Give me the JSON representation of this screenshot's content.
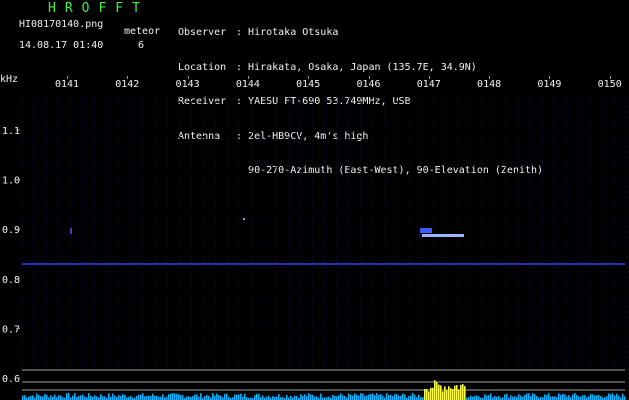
{
  "app_title": "HROFFT",
  "file_name": "HI08170140.png",
  "timestamp": "14.08.17 01:40",
  "meteor_label": "meteor",
  "meteor_count": "6",
  "station": [
    {
      "key": "Observer",
      "value": "Hirotaka Otsuka"
    },
    {
      "key": "Location",
      "value": "Hirakata, Osaka, Japan (135.7E, 34.9N)"
    },
    {
      "key": "Receiver",
      "value": "YAESU FT-690 53.749MHz, USB"
    },
    {
      "key": "Antenna",
      "value": "2el-HB9CV, 4m's high"
    },
    {
      "key": "",
      "value": "90-270-Azimuth (East-West), 90-Elevation (Zenith)"
    }
  ],
  "freq_unit": "kHz",
  "time_ticks": [
    "0141",
    "0142",
    "0143",
    "0144",
    "0145",
    "0146",
    "0147",
    "0148",
    "0149",
    "0150"
  ],
  "freq_ticks": [
    "1.1",
    "1.0",
    "0.9",
    "0.8",
    "0.7",
    "0.6"
  ],
  "colors": {
    "carrier": "#3a3aff",
    "echo": "#9ab4ff",
    "burst": "#ffff40",
    "noise": "#00b4ff",
    "grid": "#0a0a3a"
  }
}
